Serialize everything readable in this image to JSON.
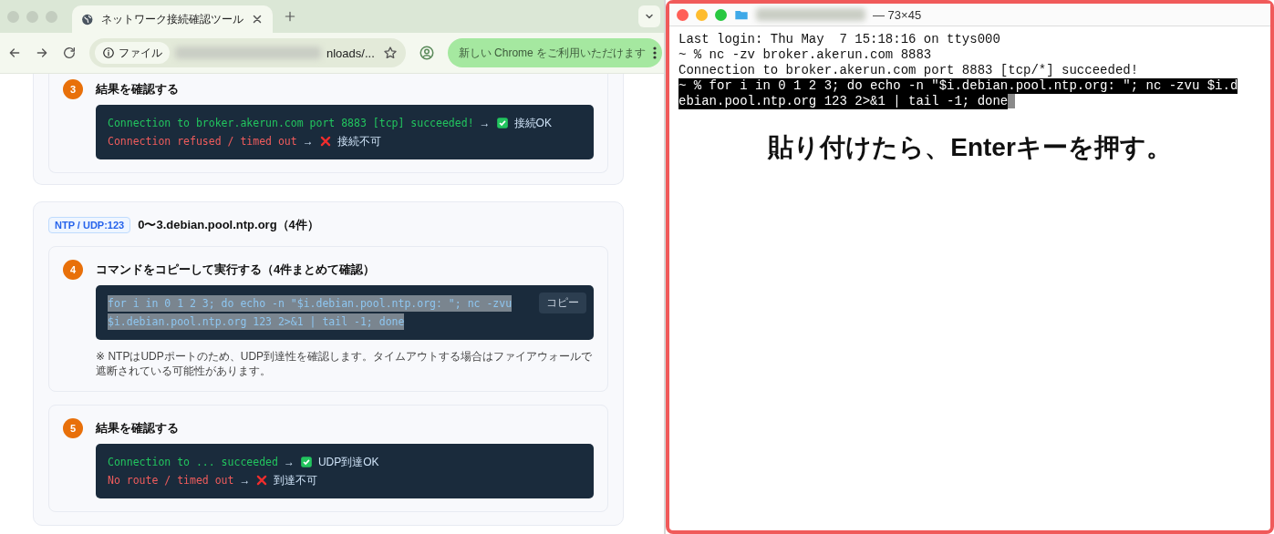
{
  "browser": {
    "tab": {
      "title": "ネットワーク接続確認ツール",
      "selected": true
    },
    "toolbar": {
      "scheme_chip": "ファイル",
      "url": "nloads/...",
      "update_button": "新しい Chrome をご利用いただけます"
    }
  },
  "sections": [
    {
      "steps": [
        {
          "number": "3",
          "kind": "result",
          "title": "結果を確認する",
          "lines": [
            {
              "kind": "ok",
              "code": "Connection to broker.akerun.com port 8883 [tcp] succeeded!",
              "arrow": "→",
              "label": "接続OK"
            },
            {
              "kind": "ng",
              "code": "Connection refused / timed out",
              "arrow": "→",
              "label": "接続不可"
            }
          ]
        }
      ]
    },
    {
      "badge": "NTP / UDP:123",
      "title": "0〜3.debian.pool.ntp.org（4件）",
      "steps": [
        {
          "number": "4",
          "kind": "command",
          "title": "コマンドをコピーして実行する（4件まとめて確認）",
          "selected": true,
          "copy_label": "コピー",
          "code_lines": [
            "for i in 0 1 2 3; do echo -n \"$i.debian.pool.ntp.org: \"; nc -zvu",
            "$i.debian.pool.ntp.org 123 2>&1 | tail -1; done"
          ],
          "note": "※ NTPはUDPポートのため、UDP到達性を確認します。タイムアウトする場合はファイアウォールで遮断されている可能性があります。"
        },
        {
          "number": "5",
          "kind": "result",
          "title": "結果を確認する",
          "lines": [
            {
              "kind": "ok",
              "code": "Connection to ... succeeded",
              "arrow": "→",
              "label": "UDP到達OK"
            },
            {
              "kind": "ng",
              "code": "No route / timed out",
              "arrow": "→",
              "label": "到達不可"
            }
          ]
        }
      ]
    }
  ],
  "terminal": {
    "title_suffix": "— 73×45",
    "lines": [
      {
        "text": "Last login: Thu May  7 15:18:16 on ttys000",
        "highlighted": false
      },
      {
        "text": "~ % nc -zv broker.akerun.com 8883",
        "highlighted": false
      },
      {
        "text": "Connection to broker.akerun.com port 8883 [tcp/*] succeeded!",
        "highlighted": false
      },
      {
        "text": "~ % for i in 0 1 2 3; do echo -n \"$i.debian.pool.ntp.org: \"; nc -zvu $i.d",
        "highlighted": true
      },
      {
        "text": "ebian.pool.ntp.org 123 2>&1 | tail -1; done",
        "highlighted": true,
        "cursor": true
      }
    ],
    "caption": "貼り付けたら、Enterキーを押す。"
  }
}
